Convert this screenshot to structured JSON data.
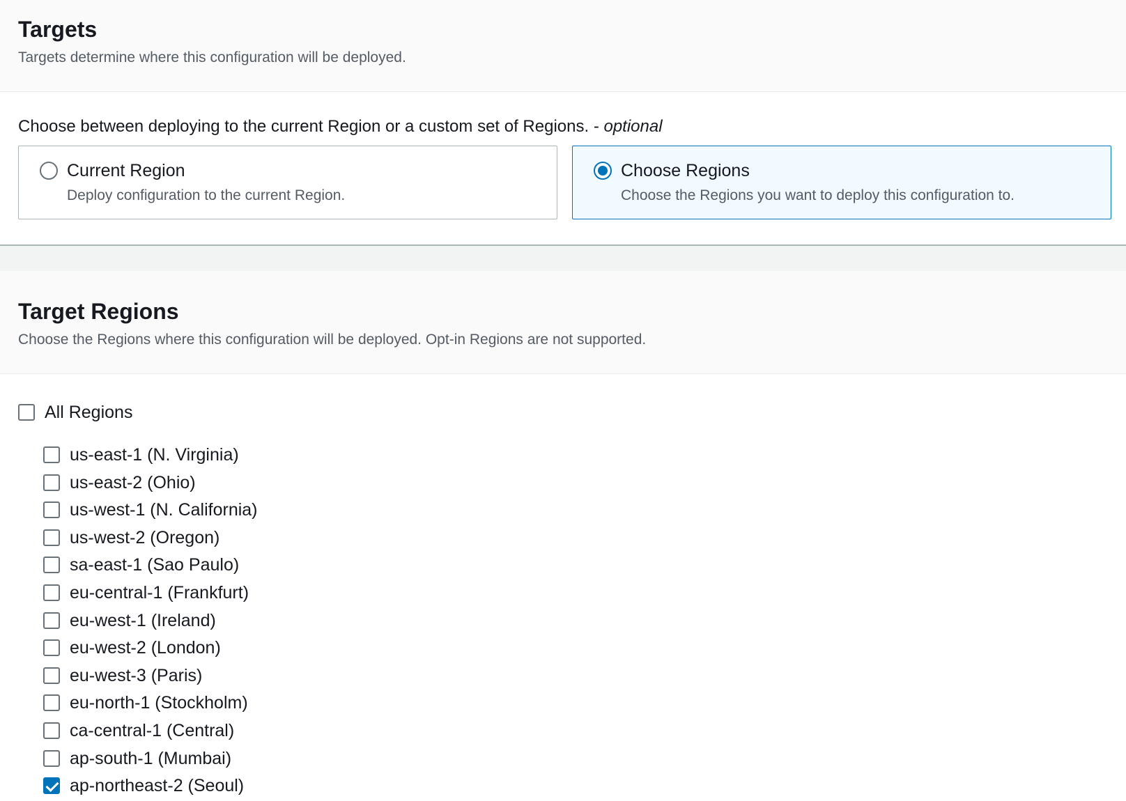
{
  "targets": {
    "title": "Targets",
    "description": "Targets determine where this configuration will be deployed.",
    "field_label": "Choose between deploying to the current Region or a custom set of Regions. -",
    "field_label_optional": "optional",
    "options": [
      {
        "title": "Current Region",
        "description": "Deploy configuration to the current Region.",
        "selected": false
      },
      {
        "title": "Choose Regions",
        "description": "Choose the Regions you want to deploy this configuration to.",
        "selected": true
      }
    ]
  },
  "target_regions": {
    "title": "Target Regions",
    "description": "Choose the Regions where this configuration will be deployed. Opt-in Regions are not supported.",
    "all_regions_label": "All Regions",
    "all_regions_checked": false,
    "regions": [
      {
        "label": "us-east-1 (N. Virginia)",
        "checked": false
      },
      {
        "label": "us-east-2 (Ohio)",
        "checked": false
      },
      {
        "label": "us-west-1 (N. California)",
        "checked": false
      },
      {
        "label": "us-west-2 (Oregon)",
        "checked": false
      },
      {
        "label": "sa-east-1 (Sao Paulo)",
        "checked": false
      },
      {
        "label": "eu-central-1 (Frankfurt)",
        "checked": false
      },
      {
        "label": "eu-west-1 (Ireland)",
        "checked": false
      },
      {
        "label": "eu-west-2 (London)",
        "checked": false
      },
      {
        "label": "eu-west-3 (Paris)",
        "checked": false
      },
      {
        "label": "eu-north-1 (Stockholm)",
        "checked": false
      },
      {
        "label": "ca-central-1 (Central)",
        "checked": false
      },
      {
        "label": "ap-south-1 (Mumbai)",
        "checked": false
      },
      {
        "label": "ap-northeast-2 (Seoul)",
        "checked": true
      }
    ]
  },
  "colors": {
    "accent": "#0073bb",
    "selected_tile_bg": "#f1faff",
    "header_bg": "#fafafa",
    "secondary_text": "#545b64"
  }
}
